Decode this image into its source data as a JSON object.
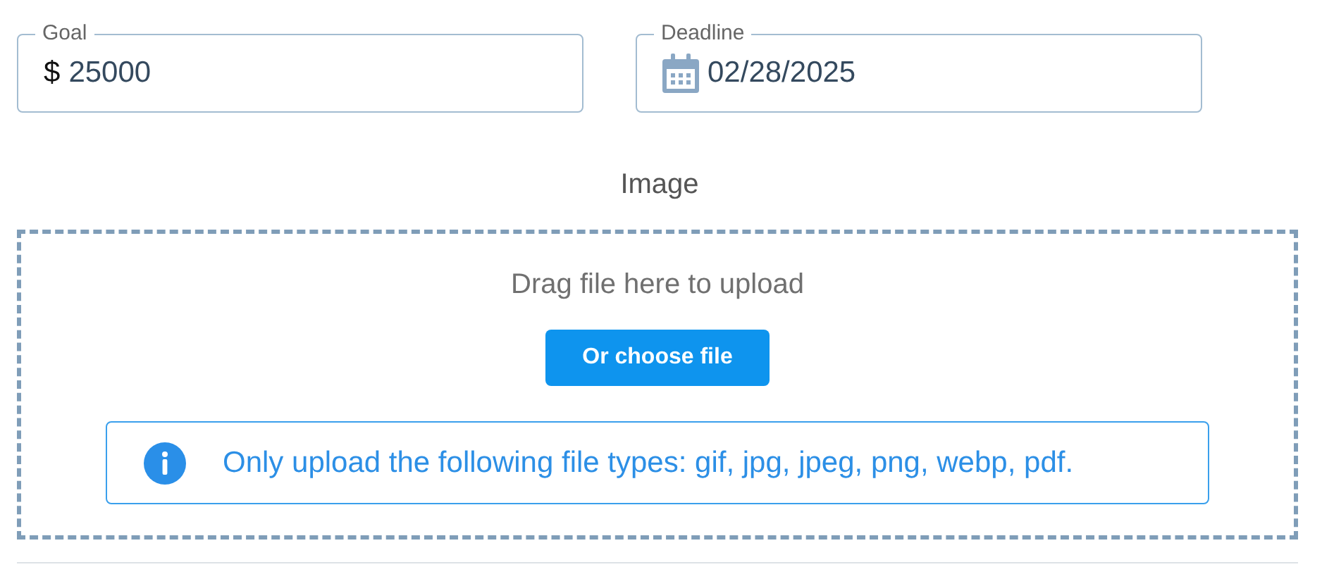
{
  "fields": [
    {
      "kind": "currency",
      "label": "Goal",
      "prefix": "$",
      "value": "25000"
    },
    {
      "kind": "date",
      "label": "Deadline",
      "value": "02/28/2025"
    }
  ],
  "image": {
    "label": "Image",
    "dropzone_text": "Drag file here to upload",
    "button": "Or choose file",
    "info": "Only upload the following file types: gif, jpg, jpeg, png, webp, pdf."
  }
}
